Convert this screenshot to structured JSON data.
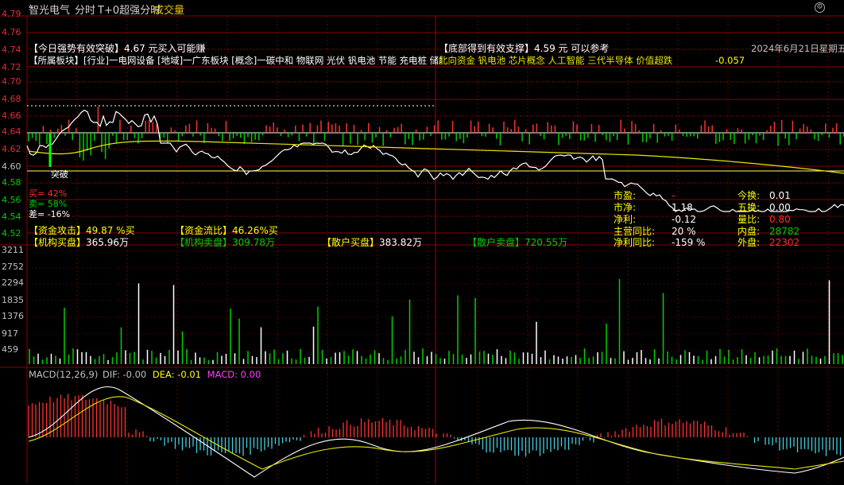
{
  "header": {
    "stock_name": "智光电气",
    "mode": "分时",
    "t0_label": "T+0超强分时",
    "indicator": "成交量"
  },
  "price_axis": [
    "4.79",
    "4.76",
    "4.74",
    "4.72",
    "4.70",
    "4.68",
    "4.66",
    "4.64",
    "4.62",
    "4.60",
    "4.58",
    "4.56",
    "4.54",
    "4.52"
  ],
  "volume_axis": [
    "3211",
    "2752",
    "2294",
    "1835",
    "1376",
    "917",
    "459"
  ],
  "overlay": {
    "strong_buy": "【今日强势有效突破】4.67 元买入可能赚",
    "support": "【底部得到有效支撑】4.59 元 可以参考",
    "date": "2024年6月21日星期五",
    "sectors": "【所属板块】[行业]一电网设备 [地域]一广东板块 [概念]一碳中和 物联网 光伏 钒电池 节能 充电桩 储能 虚拟电厂 智能电网 工业互联网 汽车零件 储能",
    "sectors_overlap": "北向资金 钒电池 芯片概念 人工智能 三代半导体 价值超跌",
    "ratio": "-0.057",
    "breakthrough": "突破",
    "buy_pct": "买= 42%",
    "sell_pct": "卖= 58%",
    "diff_pct": "差= -16%"
  },
  "capital": {
    "attack_label": "【资金攻击】",
    "attack_value": "49.87 %买",
    "flow_label": "【资金流比】",
    "flow_value": "46.26%买",
    "inst_buy_label": "【机构买盘】",
    "inst_buy_value": "365.96万",
    "inst_sell_label": "【机构卖盘】",
    "inst_sell_value": "309.78万",
    "retail_buy_label": "【散户买盘】",
    "retail_buy_value": "383.82万",
    "retail_sell_label": "【散户卖盘】",
    "retail_sell_value": "720.55万"
  },
  "financials": {
    "pe_label": "市盈:",
    "pe_value": "-",
    "pb_label": "市净:",
    "pb_value": "1.18",
    "profit_label": "净利:",
    "profit_value": "-0.12",
    "rev_label": "主营同比:",
    "rev_value": "20 %",
    "np_label": "净利同比:",
    "np_value": "-159 %",
    "turnover_label": "今换:",
    "turnover_value": "0.01",
    "five_label": "五换:",
    "five_value": "0.00",
    "vr_label": "量比:",
    "vr_value": "0.80",
    "inner_label": "内盘:",
    "inner_value": "28782",
    "outer_label": "外盘:",
    "outer_value": "22302"
  },
  "macd": {
    "name": "MACD(12,26,9)",
    "dif": "DIF: -0.00",
    "dea": "DEA: -0.01",
    "macd": "MACD: 0.00"
  },
  "colors": {
    "up": "#ff3030",
    "down": "#00d000",
    "grid": "#8b0000",
    "price_line": "#ffffff",
    "avg_line": "#e8e800",
    "yellow_text": "#ffff00",
    "cyan": "#40d0e0",
    "magenta": "#ff40ff"
  }
}
